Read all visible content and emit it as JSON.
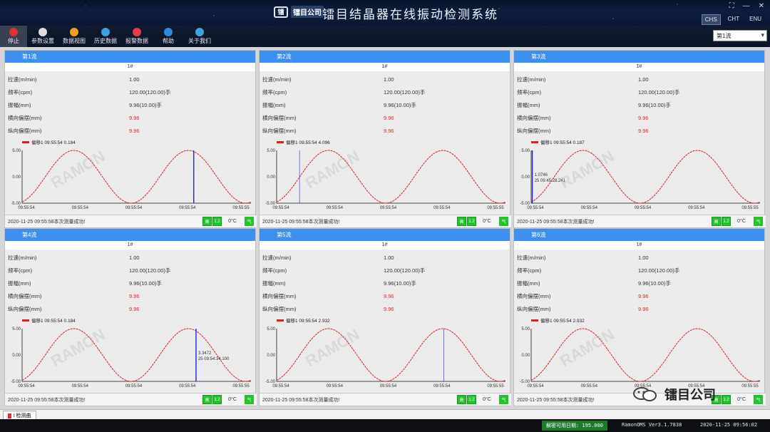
{
  "window": {
    "logo_mark": "镭",
    "logo_text": "镭目公司",
    "title": "镭目结晶器在线振动检测系统",
    "controls": [
      "⛶",
      "—",
      "✕"
    ],
    "languages": [
      {
        "code": "CHS",
        "active": true
      },
      {
        "code": "CHT",
        "active": false
      },
      {
        "code": "ENU",
        "active": false
      }
    ]
  },
  "toolbar": {
    "items": [
      {
        "name": "stop",
        "label": "停止",
        "icon": "stop-icon",
        "color": "#e03030",
        "active": true
      },
      {
        "name": "settings",
        "label": "参数设置",
        "icon": "gear-icon",
        "color": "#dcdcdc"
      },
      {
        "name": "data-view",
        "label": "数据视图",
        "icon": "grid-icon",
        "color": "#f0a020"
      },
      {
        "name": "history",
        "label": "历史数据",
        "icon": "monitor-icon",
        "color": "#3aa0e0"
      },
      {
        "name": "alarm",
        "label": "报警数据",
        "icon": "document-icon",
        "color": "#e04040"
      },
      {
        "name": "help",
        "label": "帮助",
        "icon": "info-icon",
        "color": "#2a8ae0"
      },
      {
        "name": "about",
        "label": "关于我们",
        "icon": "user-icon",
        "color": "#40a0e0"
      }
    ],
    "reel_select": "第1流"
  },
  "panels": [
    {
      "title": "第1流",
      "strand": "1#",
      "params": [
        {
          "k": "拉速(m/min)",
          "v": "1.00",
          "red": false
        },
        {
          "k": "频率(cpm)",
          "v": "120.00(120.00)手",
          "red": false
        },
        {
          "k": "振幅(mm)",
          "v": "9.96(10.00)手",
          "red": false
        },
        {
          "k": "横向偏摆(mm)",
          "v": "9.96",
          "red": true
        },
        {
          "k": "纵向偏摆(mm)",
          "v": "9.96",
          "red": true
        }
      ],
      "legend": "偏移1   09:55:54  0.184",
      "y_ticks": [
        "5.00",
        "0.00",
        "-5.00"
      ],
      "x_ticks": [
        "09:55:54",
        "09:55:54",
        "09:55:54",
        "09:55:54",
        "09:55:55"
      ],
      "cursor": 0.75,
      "cursor_label": "",
      "status": "2020-11-25 09:55:58本次测量成功!",
      "b1": "高",
      "b2": "1.2",
      "temp": "0°C",
      "end": "气"
    },
    {
      "title": "第2流",
      "strand": "1#",
      "params": [
        {
          "k": "拉速(m/min)",
          "v": "1.00",
          "red": false
        },
        {
          "k": "频率(cpm)",
          "v": "120.00(120.00)手",
          "red": false
        },
        {
          "k": "振幅(mm)",
          "v": "9.96(10.00)手",
          "red": false
        },
        {
          "k": "横向偏摆(mm)",
          "v": "9.96",
          "red": true
        },
        {
          "k": "纵向偏摆(mm)",
          "v": "9.96",
          "red": true
        }
      ],
      "legend": "偏移1   09:55:54  4.096",
      "y_ticks": [
        "5.00",
        "0.00",
        "-5.00"
      ],
      "x_ticks": [
        "09:55:54",
        "09:55:54",
        "09:55:54",
        "09:55:54",
        "09:55:55"
      ],
      "cursor": 0.1,
      "cursor_label": "",
      "status": "2020-11-25 09:55:58本次测量成功!",
      "b1": "高",
      "b2": "1.2",
      "temp": "0°C",
      "end": "气"
    },
    {
      "title": "第3流",
      "strand": "1#",
      "params": [
        {
          "k": "拉速(m/min)",
          "v": "1.00",
          "red": false
        },
        {
          "k": "频率(cpm)",
          "v": "120.00(120.00)手",
          "red": false
        },
        {
          "k": "振幅(mm)",
          "v": "9.96(10.00)手",
          "red": false
        },
        {
          "k": "横向偏摆(mm)",
          "v": "9.96",
          "red": true
        },
        {
          "k": "纵向偏摆(mm)",
          "v": "9.96",
          "red": true
        }
      ],
      "legend": "偏移1   09:55:54  0.187",
      "y_ticks": [
        "5.00",
        "0.00",
        "-5.00"
      ],
      "x_ticks": [
        "09:55:54",
        "09:55:54",
        "09:55:54",
        "09:55:54",
        "09:55:55"
      ],
      "cursor": 0.005,
      "cursor_label": "1.0746\n25 09:45:28.241",
      "status": "2020-11-25 09:55:58本次测量成功!",
      "b1": "高",
      "b2": "1.2",
      "temp": "0°C",
      "end": "气"
    },
    {
      "title": "第4流",
      "strand": "1#",
      "params": [
        {
          "k": "拉速(m/min)",
          "v": "1.00",
          "red": false
        },
        {
          "k": "频率(cpm)",
          "v": "120.00(120.00)手",
          "red": false
        },
        {
          "k": "振幅(mm)",
          "v": "9.96(10.00)手",
          "red": false
        },
        {
          "k": "横向偏摆(mm)",
          "v": "9.96",
          "red": true
        },
        {
          "k": "纵向偏摆(mm)",
          "v": "9.96",
          "red": true
        }
      ],
      "legend": "偏移1   09:55:54  0.184",
      "y_ticks": [
        "5.00",
        "0.00",
        "-5.00"
      ],
      "x_ticks": [
        "09:55:54",
        "09:55:54",
        "09:55:54",
        "09:55:54",
        "09:55:55"
      ],
      "cursor": 0.76,
      "cursor_label": "3.3472\n25 09:54:34.100",
      "status": "2020-11-25 09:55:58本次测量成功!",
      "b1": "高",
      "b2": "1.2",
      "temp": "0°C",
      "end": "气"
    },
    {
      "title": "第5流",
      "strand": "1#",
      "params": [
        {
          "k": "拉速(m/min)",
          "v": "1.00",
          "red": false
        },
        {
          "k": "频率(cpm)",
          "v": "120.00(120.00)手",
          "red": false
        },
        {
          "k": "振幅(mm)",
          "v": "9.96(10.00)手",
          "red": false
        },
        {
          "k": "横向偏摆(mm)",
          "v": "9.96",
          "red": true
        },
        {
          "k": "纵向偏摆(mm)",
          "v": "9.96",
          "red": true
        }
      ],
      "legend": "偏移1   09:55:54  2.932",
      "y_ticks": [
        "5.00",
        "0.00",
        "-5.00"
      ],
      "x_ticks": [
        "09:55:54",
        "09:55:54",
        "09:55:54",
        "09:55:54",
        "09:55:55"
      ],
      "cursor": 0.73,
      "cursor_label": "",
      "status": "2020-11-25 09:55:58本次测量成功!",
      "b1": "高",
      "b2": "1.2",
      "temp": "0°C",
      "end": "气"
    },
    {
      "title": "第6流",
      "strand": "1#",
      "params": [
        {
          "k": "拉速(m/min)",
          "v": "1.00",
          "red": false
        },
        {
          "k": "频率(cpm)",
          "v": "120.00(120.00)手",
          "red": false
        },
        {
          "k": "振幅(mm)",
          "v": "9.96(10.00)手",
          "red": false
        },
        {
          "k": "横向偏摆(mm)",
          "v": "9.96",
          "red": true
        },
        {
          "k": "纵向偏摆(mm)",
          "v": "9.96",
          "red": true
        }
      ],
      "legend": "偏移1   09:55:54  2.932",
      "y_ticks": [
        "5.00",
        "0.00",
        "-5.00"
      ],
      "x_ticks": [
        "09:55:54",
        "09:55:54",
        "09:55:54",
        "09:55:54",
        "09:55:55"
      ],
      "cursor": -1,
      "cursor_label": "",
      "status": "2020-11-25 09:55:58本次测量成功!",
      "b1": "高",
      "b2": "1.2",
      "temp": "0°C",
      "end": "气"
    }
  ],
  "bottom_tab": "i 检测曲",
  "footer": {
    "cell1": "解密可用日期: 195.000",
    "cell2": "RamonOMS Ver3.1.7838",
    "cell3": "2020-11-25 09:56:02"
  },
  "wechat_label": "镭目公司",
  "watermark_text": "RAMON",
  "colors": {
    "accent": "#3d8ff0",
    "wave": "#e02020",
    "cursor": "#2222dd",
    "ok": "#21c42b"
  }
}
